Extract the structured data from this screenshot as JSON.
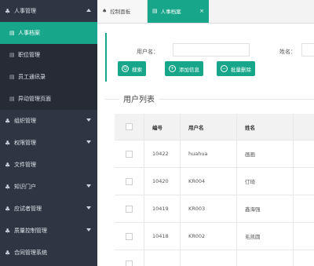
{
  "sidebar": {
    "top_group": {
      "label": "人事管理",
      "icon": "people-icon"
    },
    "sub_items": [
      {
        "label": "人事档案",
        "active": true
      },
      {
        "label": "职位管理",
        "active": false
      },
      {
        "label": "员工通讯录",
        "active": false
      },
      {
        "label": "异动管理页面",
        "active": false
      }
    ],
    "groups": [
      {
        "label": "组织管理"
      },
      {
        "label": "权限管理"
      },
      {
        "label": "文件管理"
      },
      {
        "label": "知识门户"
      },
      {
        "label": "应试者管理"
      },
      {
        "label": "质量控制管理"
      },
      {
        "label": "合同管理系统"
      }
    ]
  },
  "tabs": [
    {
      "label": "控制面板",
      "icon": "dashboard-icon"
    },
    {
      "label": "人事档案",
      "icon": "file-icon",
      "close": "×"
    }
  ],
  "search": {
    "username_label": "用户名：",
    "name_label": "姓名：",
    "buttons": [
      {
        "label": "搜索",
        "icon": "Q"
      },
      {
        "label": "添加信息",
        "icon": "+"
      },
      {
        "label": "批量删除",
        "icon": "−"
      }
    ]
  },
  "list": {
    "title": "用户列表",
    "columns": [
      "编号",
      "用户名",
      "姓名"
    ],
    "rows": [
      {
        "id": "10422",
        "username": "huahua",
        "name": "画画"
      },
      {
        "id": "10420",
        "username": "KR004",
        "name": "仃琦"
      },
      {
        "id": "10419",
        "username": "KR003",
        "name": "鑫海强"
      },
      {
        "id": "10418",
        "username": "KR002",
        "name": "毛凯圆"
      }
    ]
  },
  "colors": {
    "accent": "#17a68a",
    "sidebar_bg": "#2f3542"
  }
}
